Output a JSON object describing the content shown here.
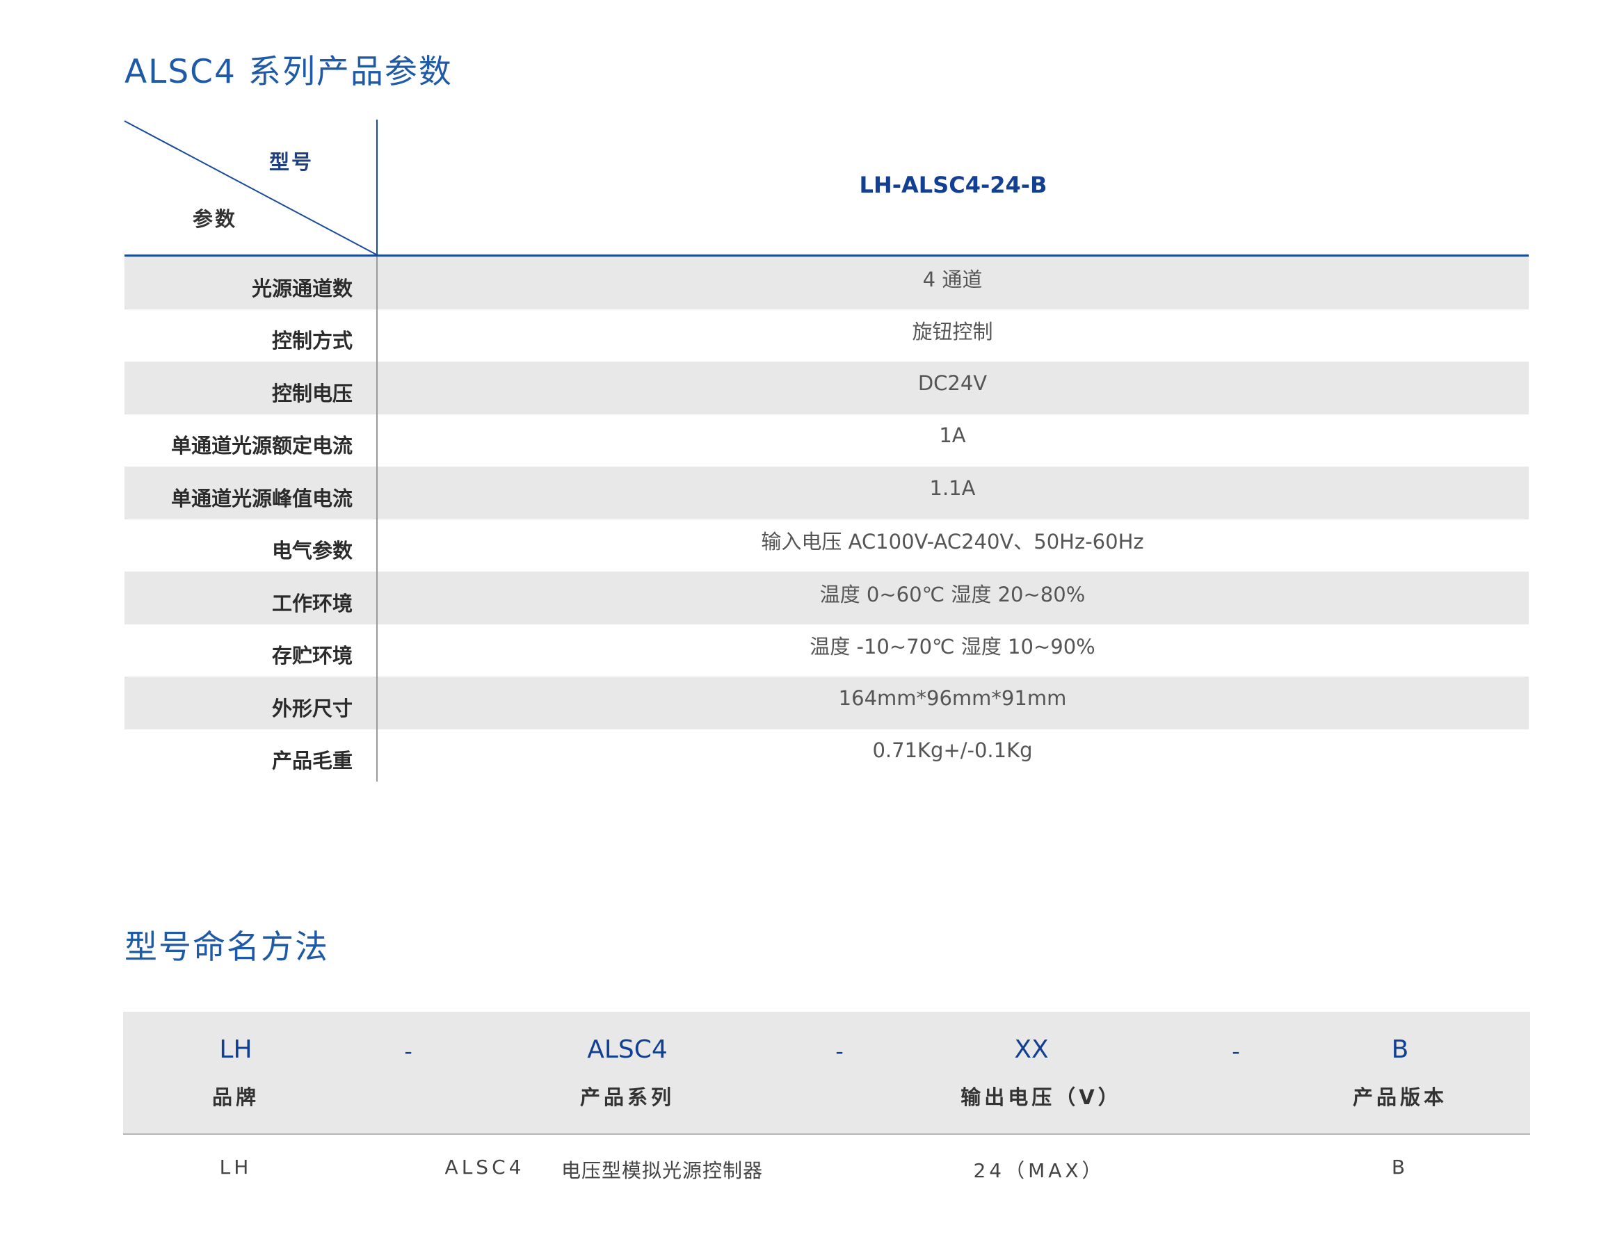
{
  "params_section": {
    "title": "ALSC4 系列产品参数",
    "header_model_label": "型号",
    "header_param_label": "参数",
    "model_name": "LH-ALSC4-24-B",
    "rows": [
      {
        "name": "光源通道数",
        "value": "4 通道"
      },
      {
        "name": "控制方式",
        "value": "旋钮控制"
      },
      {
        "name": "控制电压",
        "value": "DC24V"
      },
      {
        "name": "单通道光源额定电流",
        "value": "1A"
      },
      {
        "name": "单通道光源峰值电流",
        "value": "1.1A"
      },
      {
        "name": "电气参数",
        "value": "输入电压  AC100V-AC240V、50Hz-60Hz"
      },
      {
        "name": "工作环境",
        "value": "温度   0~60℃  湿度 20~80%"
      },
      {
        "name": "存贮环境",
        "value": "温度 -10~70℃  湿度 10~90%"
      },
      {
        "name": "外形尺寸",
        "value": "164mm*96mm*91mm"
      },
      {
        "name": "产品毛重",
        "value": "0.71Kg+/-0.1Kg"
      }
    ]
  },
  "naming_section": {
    "title": "型号命名方法",
    "segments": [
      {
        "code": "LH",
        "desc": "品牌"
      },
      {
        "code": "ALSC4",
        "desc": "产品系列"
      },
      {
        "code": "XX",
        "desc": "输出电压（V）"
      },
      {
        "code": "B",
        "desc": "产品版本"
      }
    ],
    "separator": "-",
    "example": {
      "brand": "LH",
      "series": "ALSC4",
      "series_desc": "电压型模拟光源控制器",
      "voltage": "24（MAX）",
      "version": "B"
    }
  },
  "colors": {
    "accent_blue": "#1f5aa6",
    "dark_blue": "#123f91",
    "row_shade": "#e8e8e8"
  }
}
